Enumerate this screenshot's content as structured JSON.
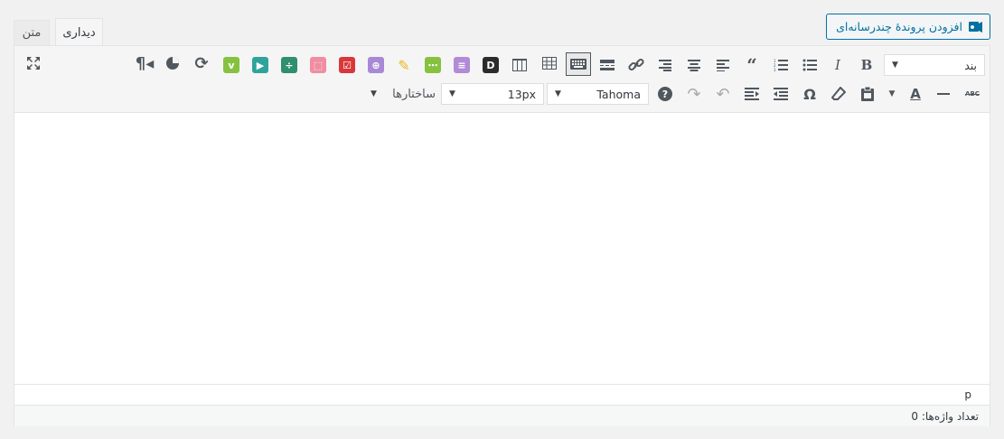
{
  "media_button": {
    "label": "افزودن پروندهٔ چندرسانه‌ای",
    "icon": "add-media-icon"
  },
  "tabs": {
    "visual": "دیداری",
    "text": "متن"
  },
  "toolbar": {
    "format_select": "بند",
    "font_family": "Tahoma",
    "font_size": "13px",
    "formats": "ساختارها",
    "colors": {
      "vimeo": "#86c240",
      "video": "#2fa39b",
      "divider": "#2f8f70",
      "box": "#f08da0",
      "checklist": "#d9383a",
      "addplus": "#a889d6",
      "dots": "#86c240",
      "list": "#b28ad8",
      "d": "#2b2b2b",
      "highlighter": "#f0b323"
    }
  },
  "path": {
    "element": "p"
  },
  "status": {
    "word_count": "تعداد واژه‌ها: 0"
  }
}
